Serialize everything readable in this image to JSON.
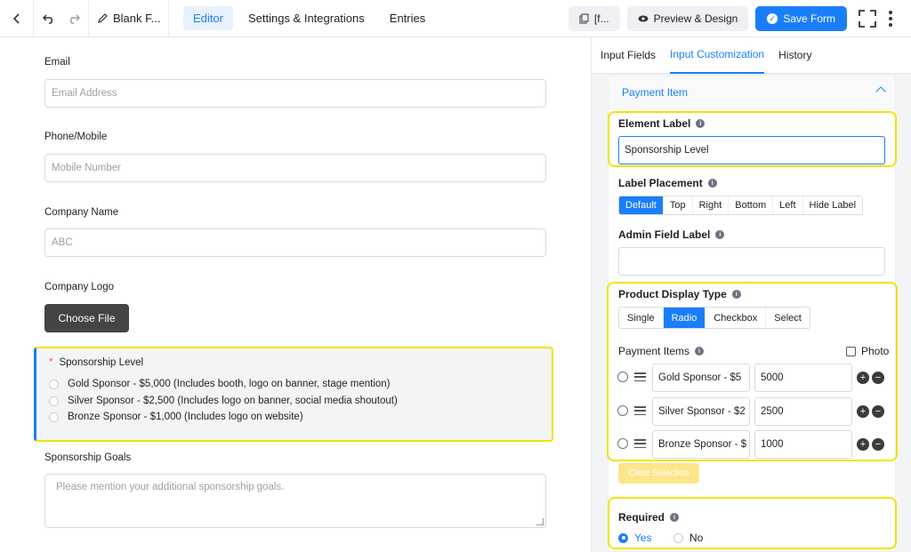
{
  "topbar": {
    "back_icon": "chevron-left-icon",
    "undo_icon": "undo-icon",
    "redo_icon": "redo-icon",
    "title_icon": "pencil-icon",
    "form_title": "Blank F...",
    "tabs": [
      {
        "label": "Editor",
        "active": true
      },
      {
        "label": "Settings & Integrations",
        "active": false
      },
      {
        "label": "Entries",
        "active": false
      }
    ],
    "shortcode_label": "[f...",
    "preview_label": "Preview & Design",
    "save_label": "Save Form",
    "accent": "#1a7efb"
  },
  "form": {
    "email": {
      "label": "Email",
      "placeholder": "Email Address"
    },
    "phone": {
      "label": "Phone/Mobile",
      "placeholder": "Mobile Number"
    },
    "company": {
      "label": "Company Name",
      "placeholder": "ABC"
    },
    "logo": {
      "label": "Company Logo",
      "button": "Choose File"
    },
    "sponsorship": {
      "required_mark": "*",
      "label": "Sponsorship Level",
      "options": [
        "Gold Sponsor - $5,000 (Includes booth, logo on banner, stage mention)",
        "Silver Sponsor - $2,500 (Includes logo on banner, social media shoutout)",
        "Bronze Sponsor - $1,000 (Includes logo on website)"
      ]
    },
    "goals": {
      "label": "Sponsorship Goals",
      "placeholder": "Please mention your additional sponsorship goals."
    }
  },
  "panel": {
    "tabs": [
      {
        "label": "Input Fields",
        "active": false
      },
      {
        "label": "Input Customization",
        "active": true
      },
      {
        "label": "History",
        "active": false
      }
    ],
    "section_title": "Payment Item",
    "element_label": {
      "label": "Element Label",
      "value": "Sponsorship Level"
    },
    "label_placement": {
      "label": "Label Placement",
      "options": [
        "Default",
        "Top",
        "Right",
        "Bottom",
        "Left",
        "Hide Label"
      ],
      "selected": "Default"
    },
    "admin_field_label": {
      "label": "Admin Field Label",
      "value": ""
    },
    "product_display_type": {
      "label": "Product Display Type",
      "options": [
        "Single",
        "Radio",
        "Checkbox",
        "Select"
      ],
      "selected": "Radio"
    },
    "payment_items": {
      "label": "Payment Items",
      "photo_label": "Photo",
      "rows": [
        {
          "name": "Gold Sponsor - $5",
          "value": "5000"
        },
        {
          "name": "Silver Sponsor - $2",
          "value": "2500"
        },
        {
          "name": "Bronze Sponsor - $",
          "value": "1000"
        }
      ]
    },
    "clear_selection": "Clear Selection",
    "required": {
      "label": "Required",
      "yes": "Yes",
      "no": "No",
      "selected": "Yes"
    },
    "highlight_color": "#f0e400"
  }
}
